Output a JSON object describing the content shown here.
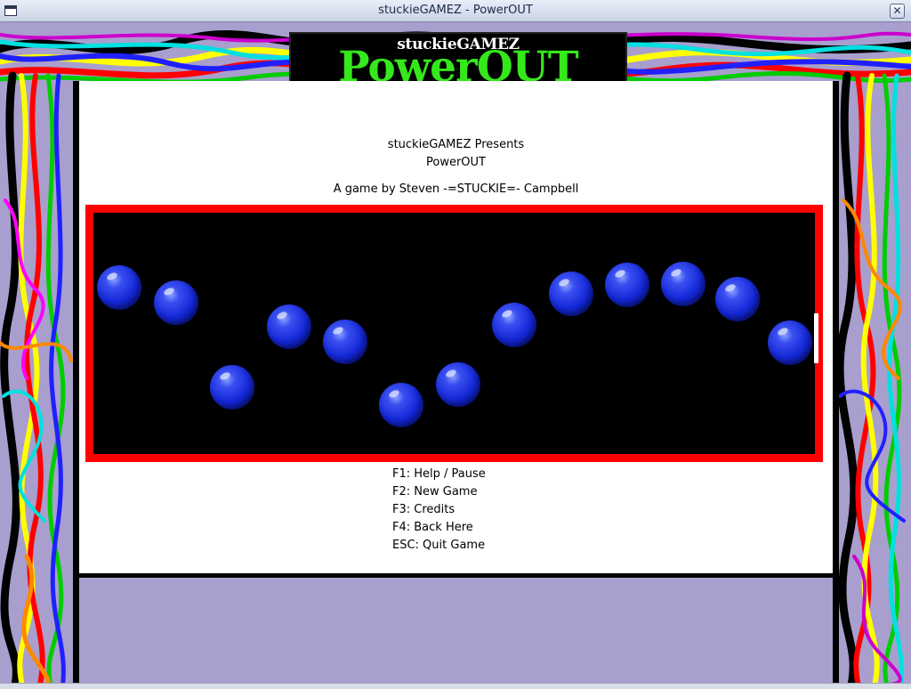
{
  "window": {
    "title": "stuckieGAMEZ - PowerOUT",
    "close_glyph": "✕"
  },
  "logo": {
    "small": "stuckieGAMEZ",
    "big": "PowerOUT"
  },
  "intro": {
    "presents": "stuckieGAMEZ Presents",
    "game_name": "PowerOUT",
    "byline": "A game by Steven -=STUCKIE=- Campbell"
  },
  "menu": [
    {
      "label": "F1: Help / Pause"
    },
    {
      "label": "F2: New Game"
    },
    {
      "label": "F3: Credits"
    },
    {
      "label": "F4: Back Here"
    },
    {
      "label": "ESC: Quit Game"
    }
  ],
  "colors": {
    "background": "#a89fce",
    "field": "#000000",
    "field_border": "#ff0000",
    "ball": "#1428d8",
    "logo_text": "#35e81b"
  },
  "icons": {
    "window_icon": "window-icon",
    "close": "close-icon"
  }
}
